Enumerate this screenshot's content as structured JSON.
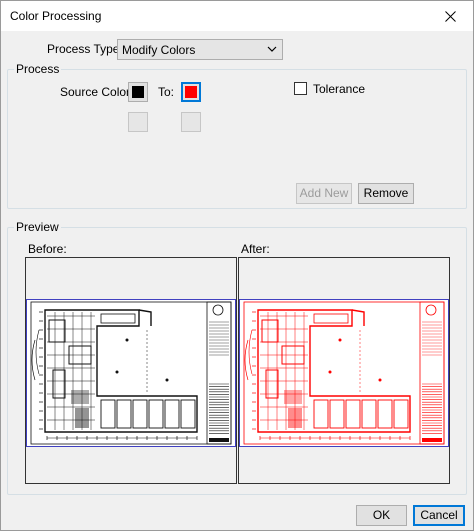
{
  "window": {
    "title": "Color Processing"
  },
  "process_type": {
    "label": "Process Type:",
    "value": "Modify Colors"
  },
  "process": {
    "title": "Process",
    "source_color_label": "Source Color:",
    "to_label": "To:",
    "source_color": "#000000",
    "target_color": "#ff0000",
    "tolerance_label": "Tolerance",
    "tolerance_checked": false,
    "add_new_label": "Add New",
    "remove_label": "Remove"
  },
  "preview": {
    "title": "Preview",
    "before_label": "Before:",
    "after_label": "After:"
  },
  "footer": {
    "ok_label": "OK",
    "cancel_label": "Cancel"
  },
  "icons": {
    "close": "close-icon",
    "dropdown": "chevron-down-icon"
  }
}
